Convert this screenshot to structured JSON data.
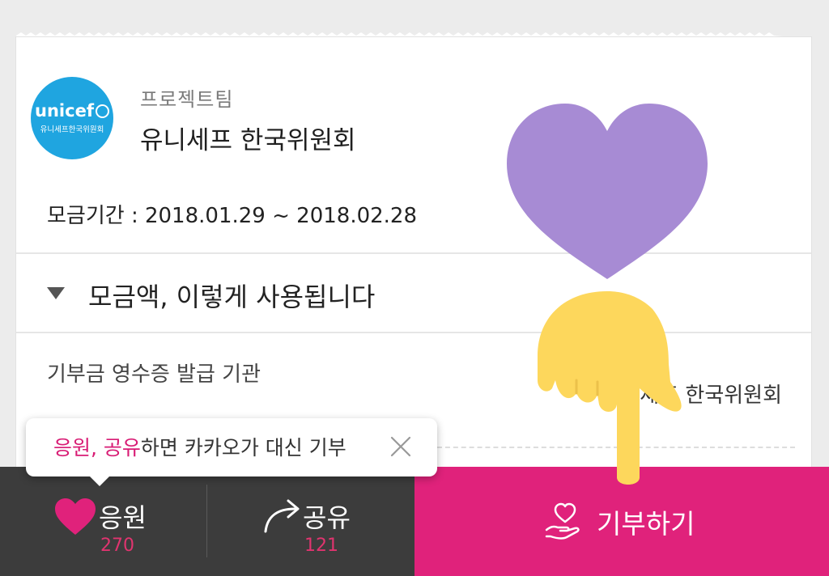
{
  "org": {
    "logo_text": "unicef",
    "logo_subtext": "유니세프한국위원회",
    "team_label": "프로젝트팀",
    "name": "유니세프 한국위원회"
  },
  "period": "모금기간 : 2018.01.29 ~ 2018.02.28",
  "accordion": {
    "label": "모금액, 이렇게 사용됩니다"
  },
  "receipt": {
    "label": "기부금 영수증 발급 기관",
    "value": "유니세프 한국위원회"
  },
  "tooltip": {
    "highlight": "응원, 공유",
    "text": "하면 카카오가 대신 기부"
  },
  "actions": {
    "cheer_label": "응원",
    "cheer_count": "270",
    "share_label": "공유",
    "share_count": "121",
    "donate_label": "기부하기"
  },
  "colors": {
    "accent_pink": "#e0227b",
    "dark_bar": "#3c3c3c",
    "unicef_blue": "#1fa5e0",
    "overlay_heart": "#a78bd4",
    "overlay_hand": "#fdd75c"
  }
}
